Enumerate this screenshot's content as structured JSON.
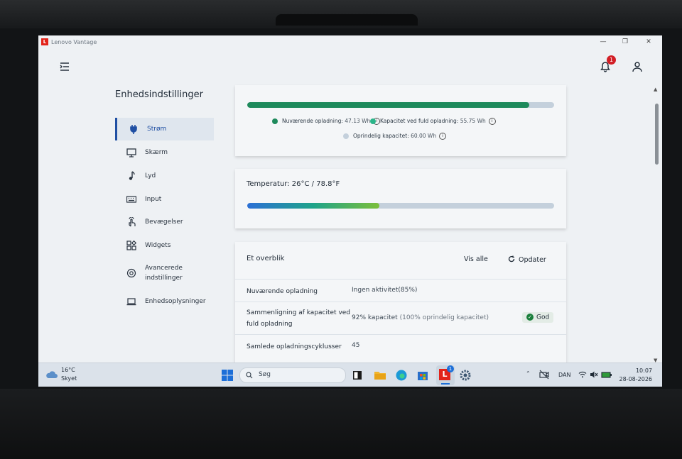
{
  "app": {
    "title": "Lenovo Vantage",
    "logo_letter": "L",
    "window_controls": [
      "—",
      "❐",
      "✕"
    ],
    "notification_count": "1"
  },
  "sidebar": {
    "title": "Enhedsindstillinger",
    "items": [
      {
        "label": "Strøm",
        "icon": "plug-icon",
        "active": true
      },
      {
        "label": "Skærm",
        "icon": "monitor-icon"
      },
      {
        "label": "Lyd",
        "icon": "music-note-icon"
      },
      {
        "label": "Input",
        "icon": "keyboard-icon"
      },
      {
        "label": "Bevægelser",
        "icon": "hand-gesture-icon"
      },
      {
        "label": "Widgets",
        "icon": "widgets-icon"
      },
      {
        "label": "Avancerede indstillinger",
        "line1": "Avancerede",
        "line2": "indstillinger",
        "icon": "advanced-settings-icon"
      },
      {
        "label": "Enhedsoplysninger",
        "icon": "laptop-icon"
      }
    ]
  },
  "battery": {
    "current_fraction": 0.92,
    "current_label": "Nuværende opladning:",
    "current_value": "47.13 Wh",
    "full_label": "Kapacitet ved fuld opladning:",
    "full_value": "55.75 Wh",
    "original_label": "Oprindelig kapacitet:",
    "original_value": "60.00 Wh",
    "colors": {
      "current": "#1e8a5c",
      "full": "#2bb58a",
      "original": "#c4d0dc"
    }
  },
  "temperature": {
    "label": "Temperatur:",
    "value": "26°C / 78.8°F",
    "fraction": 0.43
  },
  "overview": {
    "title": "Et overblik",
    "view_all": "Vis alle",
    "refresh": "Opdater",
    "rows": [
      {
        "key": "Nuværende opladning",
        "value": "Ingen aktivitet(85%)"
      },
      {
        "key": "Sammenligning af kapacitet ved fuld opladning",
        "key_line1": "Sammenligning af kapacitet ved",
        "key_line2": "fuld opladning",
        "value": "92% kapacitet",
        "value_extra": "(100% oprindelig kapacitet)",
        "badge": "God"
      },
      {
        "key": "Samlede opladningscyklusser",
        "value": "45"
      }
    ]
  },
  "taskbar": {
    "weather_temp": "16°C",
    "weather_desc": "Skyet",
    "search_placeholder": "Søg",
    "vantage_badge": "1",
    "language": "DAN",
    "time": "10:07",
    "date": "28-08-2026"
  }
}
